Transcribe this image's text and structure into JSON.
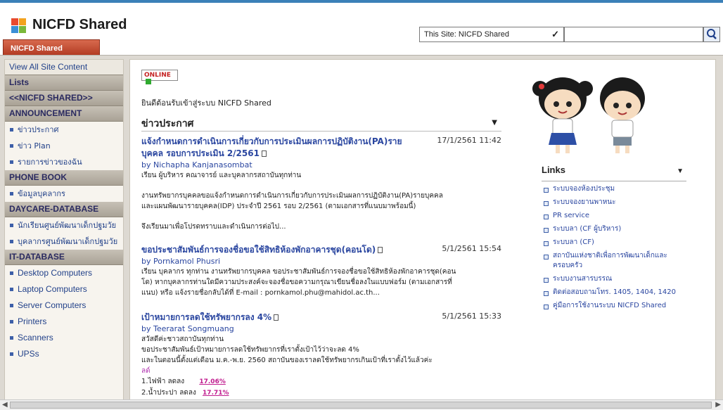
{
  "header": {
    "site_title": "NICFD Shared",
    "site_tab": "NICFD Shared",
    "search_scope": "This Site: NICFD Shared",
    "search_placeholder": ""
  },
  "leftnav": {
    "view_all": "View All Site Content",
    "lists": "Lists",
    "home_link": "<<NICFD SHARED>>",
    "sections": [
      {
        "title": "ANNOUNCEMENT",
        "items": [
          "ข่าวประกาศ",
          "ข่าว Plan",
          "รายการข่าวของฉัน"
        ]
      },
      {
        "title": "PHONE BOOK",
        "items": [
          "ข้อมูลบุคลากร"
        ]
      },
      {
        "title": "DAYCARE-DATABASE",
        "items": [
          "นักเรียนศูนย์พัฒนาเด็กปฐมวัย",
          "บุคลากรศูนย์พัฒนาเด็กปฐมวัย"
        ]
      },
      {
        "title": "IT-DATABASE",
        "items": [
          "Desktop Computers",
          "Laptop Computers",
          "Server Computers",
          "Printers",
          "Scanners",
          "UPSs"
        ]
      }
    ]
  },
  "main": {
    "online_badge": "ONLINE",
    "welcome": "ยินดีต้อนรับเข้าสู่ระบบ NICFD Shared",
    "news_title": "ข่าวประกาศ",
    "posts": [
      {
        "title": "แจ้งกำหนดการดำเนินการเกี่ยวกับการประเมินผลการปฏิบัติงาน(PA)รายบุคคล รอบการประเมิน 2/2561",
        "date": "17/1/2561 11:42",
        "author": "by Nichapha Kanjanasombat",
        "lines": [
          "เรียน ผู้บริหาร คณาจารย์ และบุคลากรสถาบันทุกท่าน",
          "",
          "งานทรัพยากรบุคคลขอแจ้งกำหนดการดำเนินการเกี่ยวกับการประเมินผลการปฏิบัติงาน(PA)รายบุคคล",
          "และแผนพัฒนารายบุคคล(IDP) ประจำปี 2561 รอบ 2/2561  (ตามเอกสารที่แนบมาพร้อมนี้)",
          "",
          "จึงเรียนมาเพื่อโปรดทราบและดำเนินการต่อไป..."
        ]
      },
      {
        "title": "ขอประชาสัมพันธ์การจองชื่อขอใช้สิทธิห้องพักอาคารชุด(คอนโด)",
        "date": "5/1/2561 15:54",
        "author": "by Pornkamol Phusri",
        "lines": [
          "เรียน บุคลากร ทุกท่าน งานทรัพยากรบุคคล ขอประชาสัมพันธ์การจองชื่อขอใช้สิทธิห้องพักอาคารชุด(คอน",
          "โด) หากบุคลากรท่านใดมีความประสงค์จะจองชื่อขอความกรุณาเขียนชื่อลงในแบบฟอร์ม (ตามเอกสารที่",
          "แนบ) หรือ แจ้งรายชื่อกลับได้ที่ E-mail : pornkamol.phu@mahidol.ac.th..."
        ]
      },
      {
        "title": "เป้าหมายการลดใช้ทรัพยากรลง 4%",
        "date": "5/1/2561 15:33",
        "author": "by Teerarat Songmuang",
        "lines": [
          "สวัสดีค่ะชาวสถาบันทุกท่าน",
          "ขอประชาสัมพันธ์เป้าหมายการลดใช้ทรัพยากรที่เราตั้งเป้าไว้ว่าจะลด 4%",
          "และในตอนนี้ตั้งแต่เดือน ม.ค.-พ.ย. 2560 สถาบันของเราลดใช้ทรัพยากรเกินเป้าที่เราตั้งไว้แล้วค่ะ"
        ],
        "extra": "ลด์",
        "stats": [
          {
            "label": "1.ไฟฟ้า ลดลง",
            "value": "17.06%"
          },
          {
            "label": "2.น้ำประปา ลดลง",
            "value": "17.71%"
          }
        ]
      }
    ]
  },
  "links": {
    "title": "Links",
    "items": [
      "ระบบจองห้องประชุม",
      "ระบบจองยานพาหนะ",
      "PR service",
      "ระบบลา (CF ผู้บริหาร)",
      "ระบบลา (CF)",
      "สถาบันแห่งชาติเพื่อการพัฒนาเด็กและครอบครัว",
      "ระบบงานสารบรรณ",
      "ติดต่อสอบถามโทร. 1405, 1404, 1420",
      "คู่มือการใช้งานระบบ NICFD Shared"
    ]
  },
  "colors": {
    "link_blue": "#2a46a0",
    "tab_red": "#b13a22",
    "online_red": "#c42121",
    "online_green": "#2faa2f"
  }
}
